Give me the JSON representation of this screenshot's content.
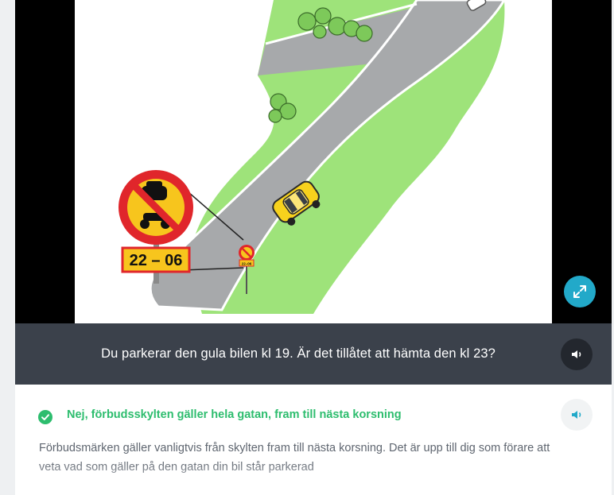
{
  "media": {
    "sign_label": "22 – 06",
    "small_sign_label": "22–06",
    "colors": {
      "road": "#a7a9ab",
      "grass": "#9ee37a",
      "sign_red": "#e0262b",
      "sign_yellow": "#f7c51d",
      "accent": "#22a9c9"
    },
    "fullscreen_icon": "expand-icon"
  },
  "question": {
    "text": "Du parkerar den gula bilen kl 19. Är det tillåtet att hämta den kl 23?",
    "audio_icon": "speaker-icon"
  },
  "answer": {
    "text": "Nej, förbudsskylten gäller hela gatan, fram till nästa korsning",
    "status_icon": "check-circle-icon",
    "status_color": "#2dbd6e",
    "explanation": "Förbudsmärken gäller vanligtvis från skylten fram till nästa korsning. Det är upp till dig som förare att veta vad som gäller på den gatan din bil står parkerad"
  }
}
